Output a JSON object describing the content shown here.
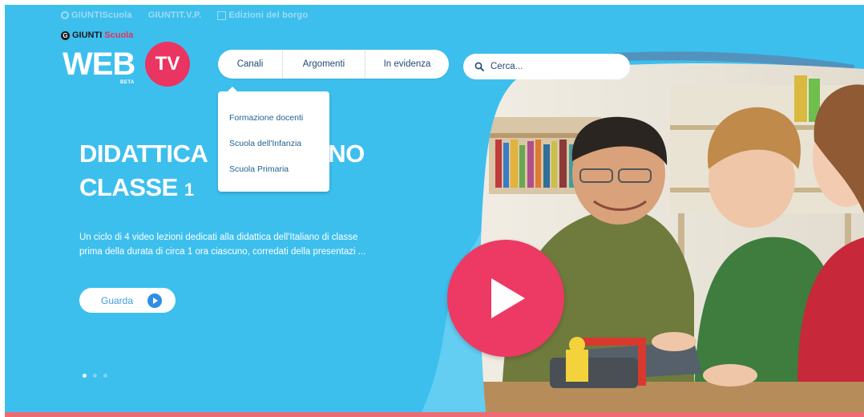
{
  "partners": [
    {
      "label": "GIUNTIScuola",
      "icon": "giunti-g-icon"
    },
    {
      "label": "GIUNTIT.V.P.",
      "icon": ""
    },
    {
      "label": "Edizioni del borgo",
      "icon": "borgo-square-icon"
    }
  ],
  "logo": {
    "brand_primary": "GIUNTI",
    "brand_secondary": "Scuola",
    "wordmark": "WEB",
    "badge": "TV",
    "beta": "BETA"
  },
  "nav": {
    "tabs": [
      "Canali",
      "Argomenti",
      "In evidenza"
    ]
  },
  "dropdown": {
    "items": [
      "Formazione docenti",
      "Scuola dell'Infanzia",
      "Scuola Primaria"
    ]
  },
  "search": {
    "placeholder": "Cerca..."
  },
  "hero": {
    "title_line1_start": "DIDATTICA",
    "title_line1_end": "NO",
    "title_line2": "CLASSE",
    "title_line2_num": "1",
    "description": "Un ciclo di 4 video lezioni dedicati alla didattica dell'Italiano di classe prima della durata di circa 1 ora ciascuno, corredati della presentazi ...",
    "watch_label": "Guarda",
    "slides_total": 3,
    "active_slide": 1
  },
  "colors": {
    "hero_bg": "#3dbfee",
    "accent_pink": "#ea3461",
    "bottom_bar": "#ef6b74",
    "button_blue": "#2f8ee0"
  }
}
